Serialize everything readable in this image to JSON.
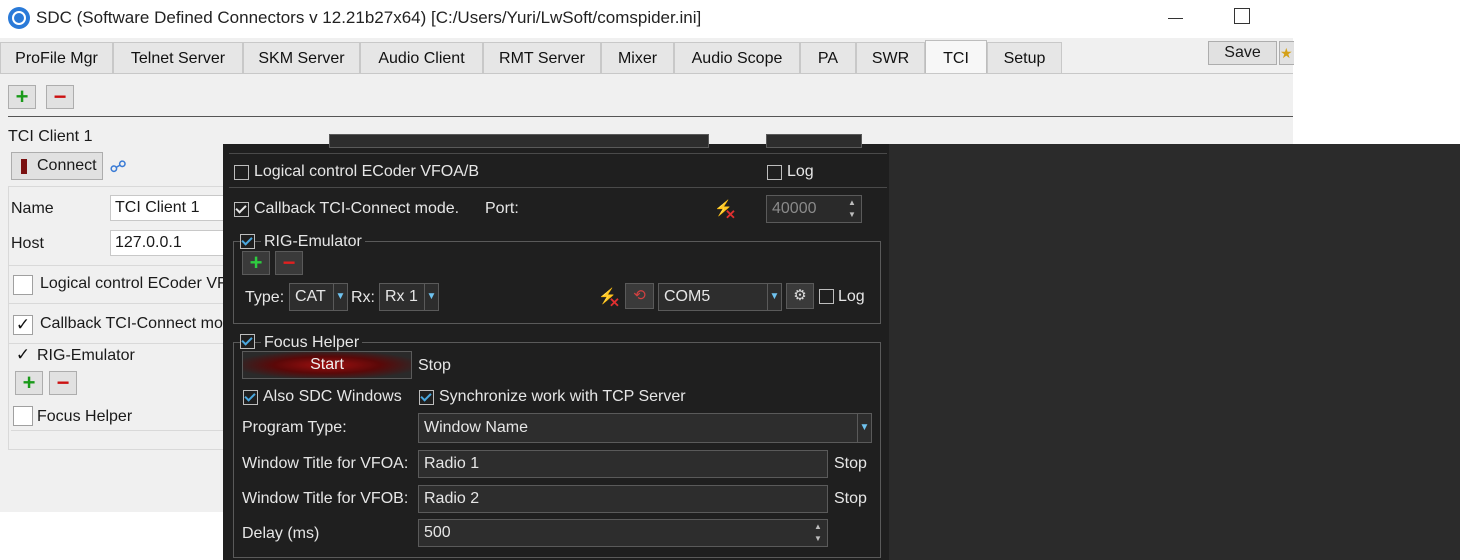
{
  "window": {
    "title": "SDC (Software Defined Connectors v 12.21b27x64) [C:/Users/Yuri/LwSoft/comspider.ini]"
  },
  "tabs": [
    {
      "label": "ProFile Mgr"
    },
    {
      "label": "Telnet Server"
    },
    {
      "label": "SKM Server"
    },
    {
      "label": "Audio Client"
    },
    {
      "label": "RMT Server"
    },
    {
      "label": "Mixer"
    },
    {
      "label": "Audio Scope"
    },
    {
      "label": "PA"
    },
    {
      "label": "SWR"
    },
    {
      "label": "TCI",
      "active": true
    },
    {
      "label": "Setup"
    }
  ],
  "toolbar": {
    "save_label": "Save",
    "add_label": "+",
    "remove_label": "−"
  },
  "client": {
    "title": "TCI Client 1",
    "connect_label": "Connect",
    "name_label": "Name",
    "name_value": "TCI Client 1",
    "host_label": "Host",
    "host_value": "127.0.0.1",
    "logical_control_label": "Logical control ECoder VF",
    "callback_label": "Callback TCI-Connect moc",
    "callback_checked": true,
    "rig_emulator_label": "RIG-Emulator",
    "rig_emulator_checked": true,
    "focus_helper_label": "Focus Helper",
    "focus_helper_checked": false,
    "check_glyph": "✓"
  },
  "dark": {
    "logical_control_label": "Logical control ECoder VFOA/B",
    "log_label": "Log",
    "callback_label": "Callback TCI-Connect mode.",
    "port_label": "Port:",
    "port_value": "40000",
    "rig_emulator": {
      "label": "RIG-Emulator",
      "type_label": "Type:",
      "type_value": "CAT",
      "rx_label": "Rx:",
      "rx_value": "Rx 1",
      "com_value": "COM5",
      "log_label": "Log"
    },
    "focus_helper": {
      "label": "Focus Helper",
      "start_label": "Start",
      "stop_label": "Stop",
      "also_sdc_label": "Also SDC Windows",
      "sync_label": "Synchronize work with TCP Server",
      "program_type_label": "Program Type:",
      "program_type_value": "Window Name",
      "vfoa_label": "Window Title for VFOA:",
      "vfoa_value": "Radio 1",
      "vfoa_stop": "Stop",
      "vfob_label": "Window Title for VFOB:",
      "vfob_value": "Radio 2",
      "vfob_stop": "Stop",
      "delay_label": "Delay (ms)",
      "delay_value": "500"
    }
  },
  "colors": {
    "accent": "#2a7ad8",
    "plus": "#1a9a1a",
    "minus": "#cc1111",
    "start_button": "#8b0000",
    "checkbox_blue": "#4aa8e0"
  }
}
